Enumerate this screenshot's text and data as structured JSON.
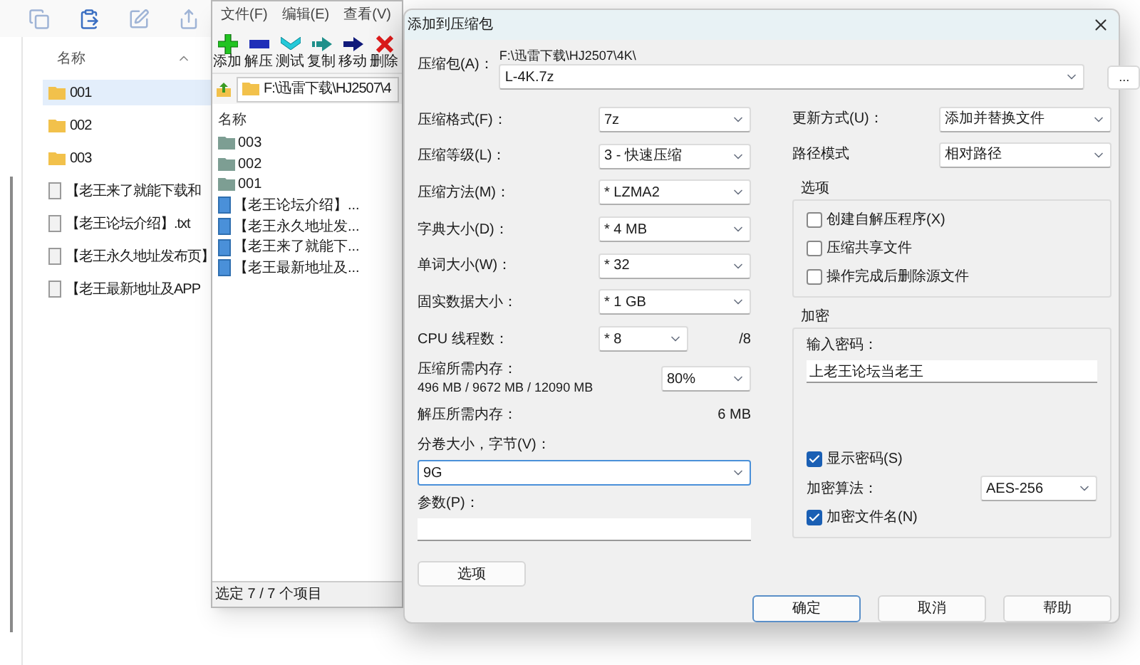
{
  "explorer": {
    "column_header": "名称",
    "items": [
      {
        "name": "001",
        "kind": "folder",
        "selected": true
      },
      {
        "name": "002",
        "kind": "folder",
        "selected": false
      },
      {
        "name": "003",
        "kind": "folder",
        "selected": false
      },
      {
        "name": "【老王来了就能下载和",
        "kind": "file",
        "selected": false
      },
      {
        "name": "【老王论坛介绍】.txt",
        "kind": "file",
        "selected": false
      },
      {
        "name": "【老王永久地址发布页】",
        "kind": "file",
        "selected": false
      },
      {
        "name": "【老王最新地址及APP",
        "kind": "file",
        "selected": false
      }
    ]
  },
  "archiver": {
    "menu": [
      "文件(F)",
      "编辑(E)",
      "查看(V)"
    ],
    "toolbar": [
      {
        "label": "添加",
        "kind": "add"
      },
      {
        "label": "解压",
        "kind": "extract"
      },
      {
        "label": "测试",
        "kind": "test"
      },
      {
        "label": "复制",
        "kind": "copy"
      },
      {
        "label": "移动",
        "kind": "move"
      },
      {
        "label": "删除",
        "kind": "delete"
      }
    ],
    "address": "F:\\迅雷下载\\HJ2507\\4",
    "column_header": "名称",
    "items": [
      {
        "name": "003",
        "kind": "folder"
      },
      {
        "name": "002",
        "kind": "folder"
      },
      {
        "name": "001",
        "kind": "folder"
      },
      {
        "name": "【老王论坛介绍】...",
        "kind": "file"
      },
      {
        "name": "【老王永久地址发...",
        "kind": "file"
      },
      {
        "name": "【老王来了就能下...",
        "kind": "file"
      },
      {
        "name": "【老王最新地址及...",
        "kind": "file"
      }
    ],
    "status": "选定 7 / 7 个项目"
  },
  "dialog": {
    "title": "添加到压缩包",
    "archive": {
      "label": "压缩包(A)：",
      "path": "F:\\迅雷下载\\HJ2507\\4K\\",
      "value": "L-4K.7z"
    },
    "browse_button": "...",
    "left_fields": [
      {
        "kind": "combo",
        "label": "压缩格式(F)：",
        "value": "7z"
      },
      {
        "kind": "combo",
        "label": "压缩等级(L)：",
        "value": "3 - 快速压缩"
      },
      {
        "kind": "combo",
        "label": "压缩方法(M)：",
        "value": "* LZMA2"
      },
      {
        "kind": "combo",
        "label": "字典大小(D)：",
        "value": "* 4 MB"
      },
      {
        "kind": "combo",
        "label": "单词大小(W)：",
        "value": "* 32"
      },
      {
        "kind": "combo",
        "label": "固实数据大小：",
        "value": "* 1 GB"
      },
      {
        "kind": "combo_suffix",
        "label": "CPU 线程数：",
        "value": "* 8",
        "suffix": "/8"
      },
      {
        "kind": "memory",
        "label": "压缩所需内存：",
        "detail": "496 MB / 9672 MB / 12090 MB",
        "value": "80%"
      },
      {
        "kind": "reading",
        "label": "解压所需内存：",
        "value": "6 MB"
      },
      {
        "kind": "wide_combo",
        "label": "分卷大小，字节(V)：",
        "value": "9G",
        "focused": true
      },
      {
        "kind": "wide_input",
        "label": "参数(P)："
      }
    ],
    "options_button": "选项",
    "right_fields": [
      {
        "label": "更新方式(U)：",
        "value": "添加并替换文件"
      },
      {
        "label": "路径模式",
        "value": "相对路径"
      }
    ],
    "options_group": {
      "title": "选项",
      "checkboxes": [
        {
          "label": "创建自解压程序(X)",
          "checked": false
        },
        {
          "label": "压缩共享文件",
          "checked": false
        },
        {
          "label": "操作完成后删除源文件",
          "checked": false
        }
      ]
    },
    "encryption": {
      "title": "加密",
      "password_label": "输入密码：",
      "password": "上老王论坛当老王",
      "show_password": {
        "label": "显示密码(S)",
        "checked": true
      },
      "algorithm": {
        "label": "加密算法：",
        "value": "AES-256"
      },
      "encrypt_names": {
        "label": "加密文件名(N)",
        "checked": true
      }
    },
    "buttons": [
      {
        "label": "确定",
        "default": true
      },
      {
        "label": "取消",
        "default": false
      },
      {
        "label": "帮助",
        "default": false
      }
    ]
  }
}
